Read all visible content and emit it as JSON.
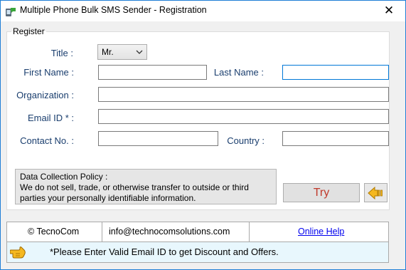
{
  "window": {
    "title": "Multiple Phone Bulk SMS Sender - Registration",
    "close_glyph": "✕"
  },
  "register": {
    "legend": "Register",
    "title_label": "Title :",
    "title_value": "Mr.",
    "first_name_label": "First Name :",
    "first_name_value": "",
    "last_name_label": "Last Name :",
    "last_name_value": "",
    "organization_label": "Organization :",
    "organization_value": "",
    "email_label": "Email ID * :",
    "email_value": "",
    "contact_label": "Contact No. :",
    "contact_value": "",
    "country_label": "Country :",
    "country_value": ""
  },
  "policy": {
    "heading": "Data Collection Policy :",
    "line1": "We do not sell, trade, or otherwise transfer to outside or third",
    "line2": "parties your personally identifiable information."
  },
  "actions": {
    "try_label": "Try",
    "back_icon": "arrow-left-icon"
  },
  "footer": {
    "company": "© TecnoCom",
    "email": "info@technocomsolutions.com",
    "help_link": "Online Help"
  },
  "notice": {
    "icon": "pointing-hand-icon",
    "message": "*Please Enter Valid Email ID to get Discount and Offers."
  },
  "colors": {
    "label_text": "#1a3e6e",
    "try_text": "#c0392b",
    "link": "#0000ee",
    "notice_bg": "#e8f7fd",
    "focus_border": "#0078d7"
  }
}
